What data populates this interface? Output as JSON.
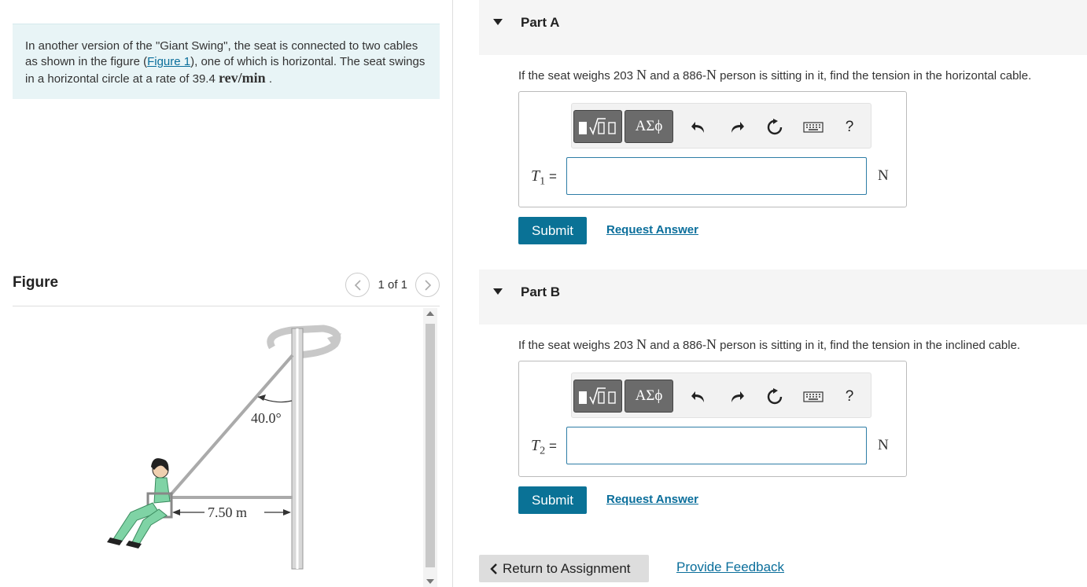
{
  "problem": {
    "text_before": "In another version of the \"Giant Swing\", the seat is connected to two cables as shown in the figure (",
    "figure_link": "Figure 1",
    "text_middle": "), one of which is horizontal. The seat swings in a horizontal circle at a rate of 39.4 ",
    "rate_unit": "rev/min",
    "text_after": " ."
  },
  "figure": {
    "title": "Figure",
    "pager_text": "1 of 1",
    "angle_label": "40.0°",
    "distance_label": "7.50 m"
  },
  "parts": [
    {
      "label": "Part A",
      "q_pre": "If the seat weighs 203 ",
      "q_unit1": "N",
      "q_mid": " and a 886-",
      "q_unit2": "N",
      "q_post": " person is sitting in it, find the tension in the horizontal cable.",
      "var_main": "T",
      "var_sub": "1",
      "equals": "=",
      "unit": "N",
      "greek_label": "ΑΣϕ",
      "help_label": "?",
      "submit_label": "Submit",
      "request_label": "Request Answer"
    },
    {
      "label": "Part B",
      "q_pre": "If the seat weighs 203 ",
      "q_unit1": "N",
      "q_mid": " and a 886-",
      "q_unit2": "N",
      "q_post": " person is sitting in it, find the tension in the inclined cable.",
      "var_main": "T",
      "var_sub": "2",
      "equals": "=",
      "unit": "N",
      "greek_label": "ΑΣϕ",
      "help_label": "?",
      "submit_label": "Submit",
      "request_label": "Request Answer"
    }
  ],
  "footer": {
    "return_label": "Return to Assignment",
    "feedback_label": "Provide Feedback"
  },
  "colors": {
    "accent": "#0a7296",
    "link": "#0a6e9b",
    "problem_bg": "#e8f4f6"
  },
  "icons": [
    "templates-icon",
    "greek-letters-icon",
    "undo-icon",
    "redo-icon",
    "reset-icon",
    "keyboard-icon",
    "help-icon",
    "chevron-left-icon",
    "chevron-right-icon",
    "caret-down-icon"
  ]
}
